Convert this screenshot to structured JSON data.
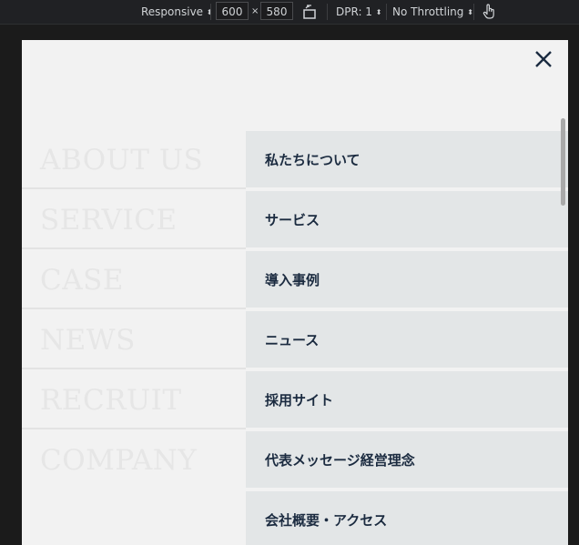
{
  "toolbar": {
    "device_label": "Responsive",
    "width_value": "600",
    "times": "×",
    "height_value": "580",
    "dpr_label": "DPR: 1",
    "throttling_label": "No Throttling"
  },
  "icons": {
    "rotate": "rotate-icon",
    "touch": "touch-hand-icon",
    "close": "close-icon"
  },
  "colors": {
    "viewport_bg": "#f2f2f2",
    "menu_jp_bg": "#e3e6e7",
    "jp_text": "#1b2b40",
    "en_text": "#e6e6e6"
  },
  "menu": {
    "items": [
      {
        "en": "ABOUT US",
        "jp": "私たちについて"
      },
      {
        "en": "SERVICE",
        "jp": "サービス"
      },
      {
        "en": "CASE",
        "jp": "導入事例"
      },
      {
        "en": "NEWS",
        "jp": "ニュース"
      },
      {
        "en": "RECRUIT",
        "jp": "採用サイト"
      },
      {
        "en": "COMPANY",
        "jp": "代表メッセージ経営理念"
      },
      {
        "en": "",
        "jp": "会社概要・アクセス"
      }
    ]
  }
}
